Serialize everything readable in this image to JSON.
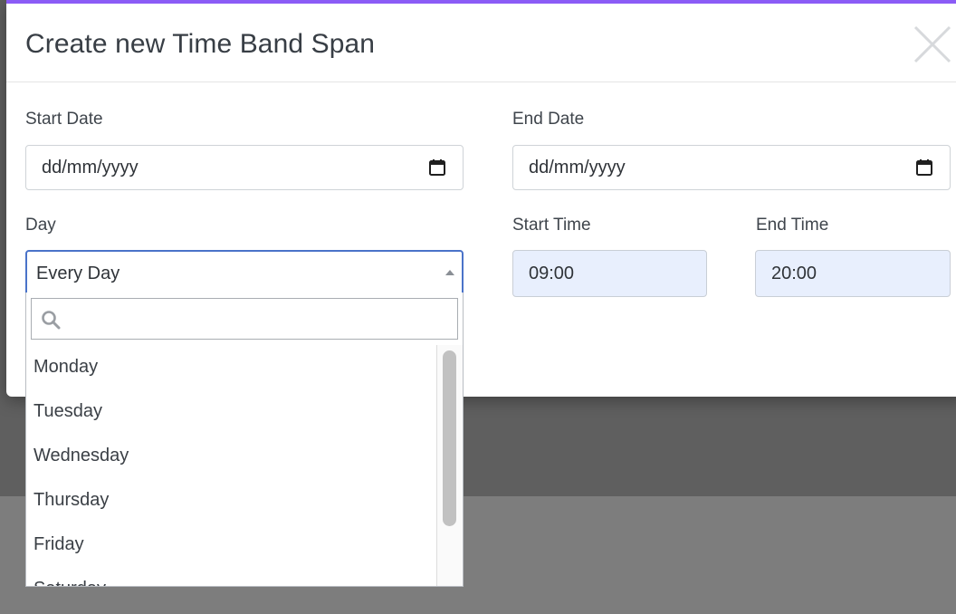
{
  "modal": {
    "title": "Create new Time Band Span",
    "accent_color": "#8b5cf6"
  },
  "fields": {
    "start_date": {
      "label": "Start Date",
      "value": "dd/mm/yyyy"
    },
    "end_date": {
      "label": "End Date",
      "value": "dd/mm/yyyy"
    },
    "day": {
      "label": "Day",
      "selected": "Every Day"
    },
    "start_time": {
      "label": "Start Time",
      "value": "09:00"
    },
    "end_time": {
      "label": "End Time",
      "value": "20:00"
    }
  },
  "dropdown": {
    "search_placeholder": "",
    "options": [
      "Monday",
      "Tuesday",
      "Wednesday",
      "Thursday",
      "Friday",
      "Saturday"
    ]
  },
  "icons": {
    "close": "close-icon",
    "calendar": "calendar-icon",
    "search": "search-icon"
  }
}
